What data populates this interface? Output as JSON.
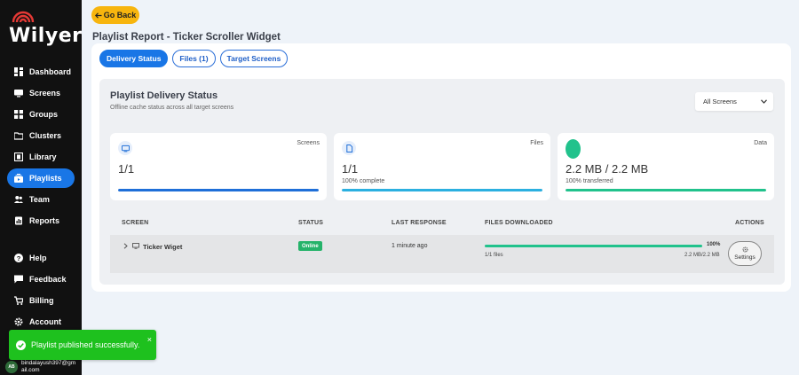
{
  "brand": {
    "name": "Wilyer",
    "accent": "#1976e6",
    "logo_arc_color": "#e53935"
  },
  "sidebar": {
    "items": [
      {
        "label": "Dashboard",
        "icon": "dashboard-icon"
      },
      {
        "label": "Screens",
        "icon": "screen-icon"
      },
      {
        "label": "Groups",
        "icon": "grid-icon"
      },
      {
        "label": "Clusters",
        "icon": "folder-icon"
      },
      {
        "label": "Library",
        "icon": "film-icon"
      },
      {
        "label": "Playlists",
        "icon": "playlist-icon",
        "active": true
      },
      {
        "label": "Team",
        "icon": "team-icon"
      },
      {
        "label": "Reports",
        "icon": "report-icon"
      },
      {
        "label": "Help",
        "icon": "help-icon"
      },
      {
        "label": "Feedback",
        "icon": "feedback-icon"
      },
      {
        "label": "Billing",
        "icon": "cart-icon"
      },
      {
        "label": "Account",
        "icon": "gear-icon"
      }
    ],
    "user": {
      "initials": "AB",
      "email": "bindalayush397@gmail.com"
    }
  },
  "toast": {
    "message": "Playlist published successfully.",
    "close": "×"
  },
  "header": {
    "back_label": "Go Back",
    "title": "Playlist Report - Ticker Scroller Widget"
  },
  "tabs": [
    {
      "label": "Delivery Status",
      "active": true
    },
    {
      "label": "Files (1)"
    },
    {
      "label": "Target Screens"
    }
  ],
  "panel": {
    "title": "Playlist Delivery Status",
    "subtitle": "Offline cache status across all target screens",
    "filter": {
      "selected": "All Screens"
    }
  },
  "stats": [
    {
      "label": "Screens",
      "value": "1/1",
      "sub": "",
      "progress": 1.0,
      "color": "#1f6fd8"
    },
    {
      "label": "Files",
      "value": "1/1",
      "sub": "100% complete",
      "progress": 1.0,
      "color": "#2bb0e0"
    },
    {
      "label": "Data",
      "value": "2.2 MB / 2.2 MB",
      "sub": "100% transferred",
      "progress": 1.0,
      "color": "#21c28c"
    }
  ],
  "table": {
    "headers": {
      "screen": "SCREEN",
      "status": "STATUS",
      "last_response": "LAST RESPONSE",
      "files": "FILES DOWNLOADED",
      "actions": "ACTIONS"
    },
    "rows": [
      {
        "screen": "Ticker Wiget",
        "status": "Online",
        "last_response": "1 minute ago",
        "percent": "100%",
        "progress": 1.0,
        "files": "1/1 files",
        "size": "2.2 MB/2.2 MB",
        "action": "Settings"
      }
    ]
  }
}
